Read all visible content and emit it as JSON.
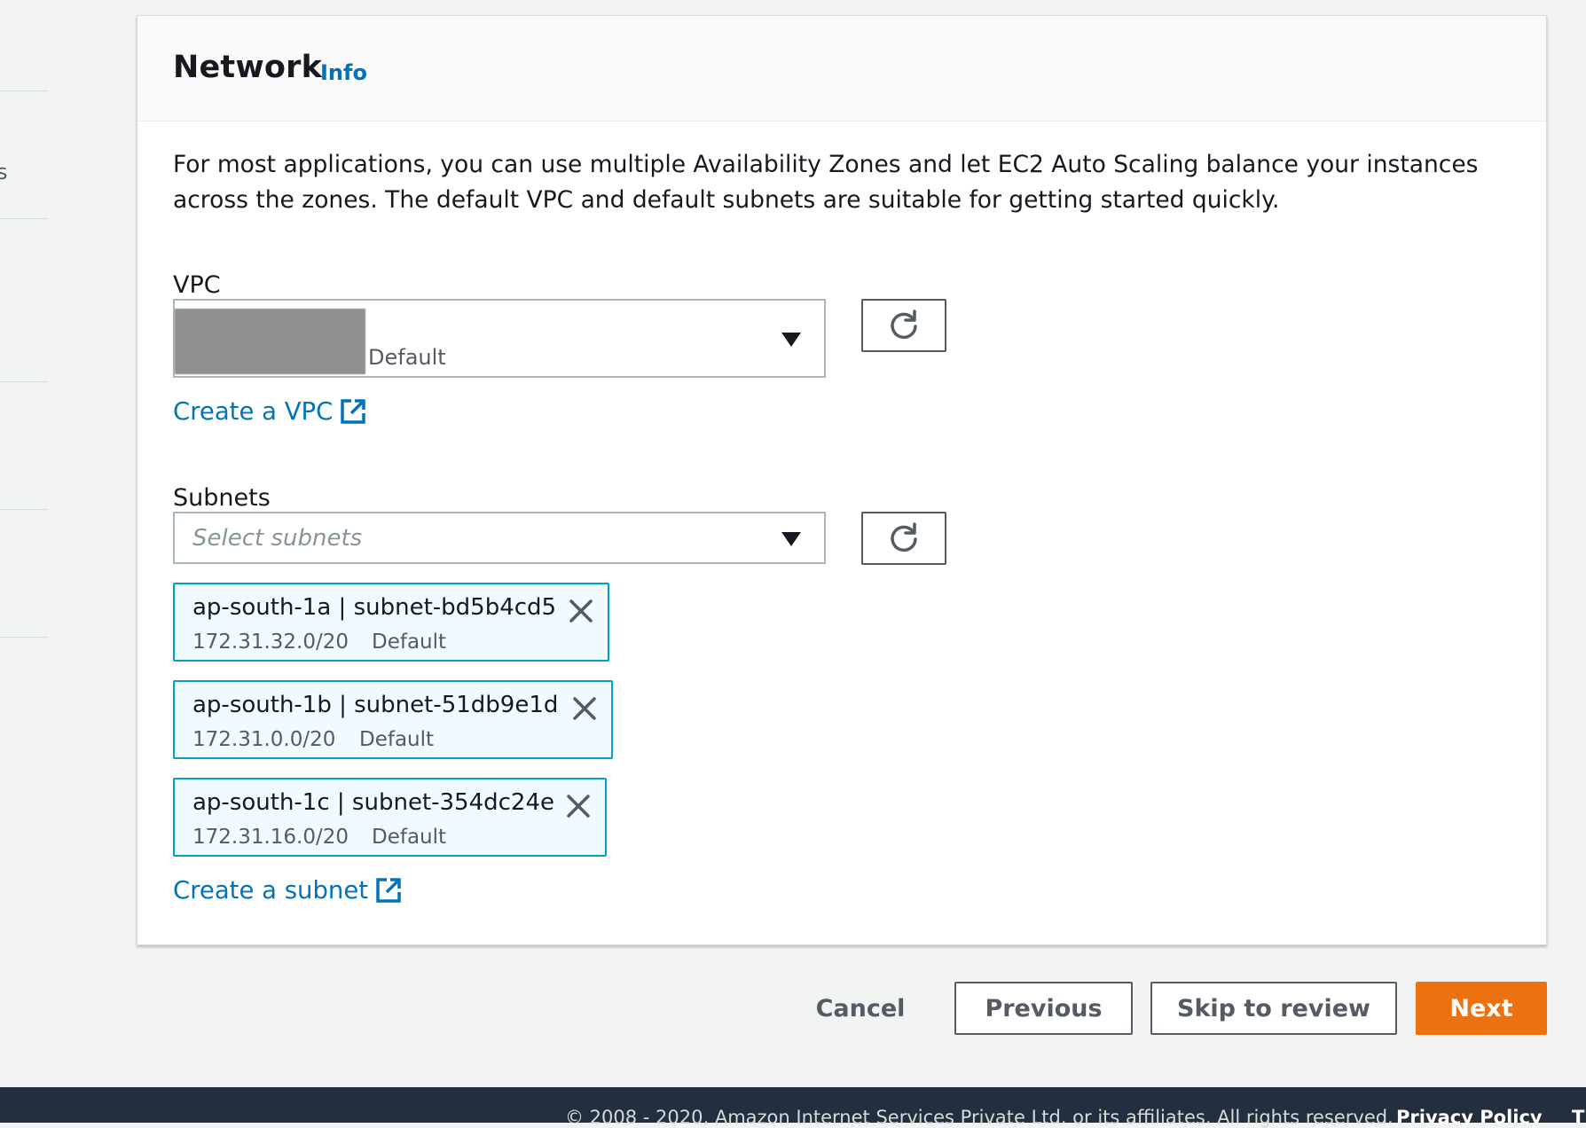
{
  "left_nav": {
    "fragment": "s"
  },
  "panel": {
    "title": "Network",
    "info_label": "Info",
    "description": "For most applications, you can use multiple Availability Zones and let EC2 Auto Scaling balance your instances across the zones. The default VPC and default subnets are suitable for getting started quickly."
  },
  "vpc": {
    "label": "VPC",
    "selected_tag": "Default",
    "create_link": "Create a VPC"
  },
  "subnets": {
    "label": "Subnets",
    "placeholder": "Select subnets",
    "selected": [
      {
        "title": "ap-south-1a | subnet-bd5b4cd5",
        "cidr": "172.31.32.0/20",
        "tag": "Default"
      },
      {
        "title": "ap-south-1b | subnet-51db9e1d",
        "cidr": "172.31.0.0/20",
        "tag": "Default"
      },
      {
        "title": "ap-south-1c | subnet-354dc24e",
        "cidr": "172.31.16.0/20",
        "tag": "Default"
      }
    ],
    "create_link": "Create a subnet"
  },
  "actions": {
    "cancel": "Cancel",
    "previous": "Previous",
    "skip": "Skip to review",
    "next": "Next"
  },
  "footer": {
    "copyright": "© 2008 - 2020, Amazon Internet Services Private Ltd. or its affiliates. All rights reserved.",
    "privacy": "Privacy Policy",
    "terms_fragment": "T"
  },
  "colors": {
    "link": "#0073bb",
    "primary": "#ec7211",
    "token_border": "#00a1c9",
    "token_bg": "#f1faff",
    "footer_bg": "#232f3e"
  },
  "icons": [
    "refresh-icon",
    "external-link-icon",
    "close-icon",
    "caret-down-icon"
  ]
}
